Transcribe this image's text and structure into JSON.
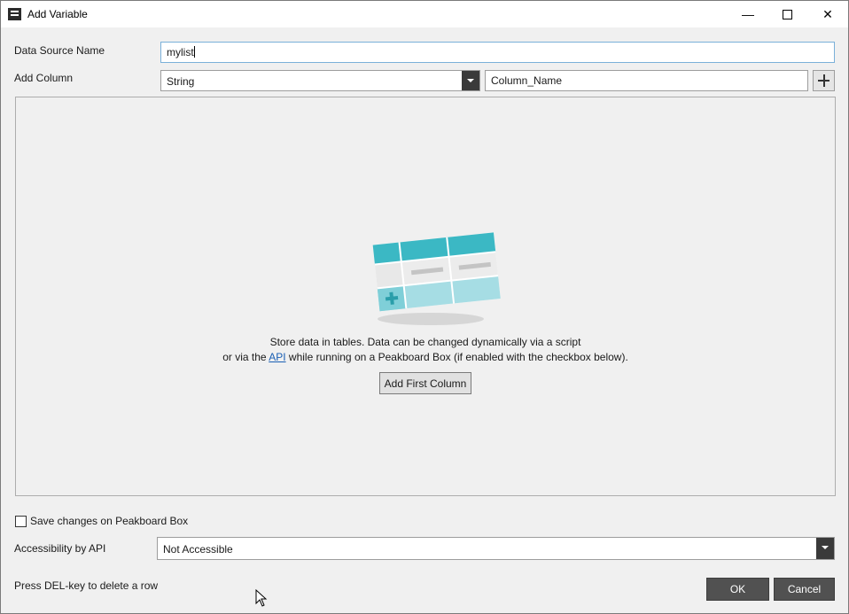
{
  "window": {
    "title": "Add Variable",
    "minimize_icon": "minimize-icon",
    "maximize_icon": "maximize-icon",
    "close_icon": "close-icon"
  },
  "form": {
    "data_source_label": "Data Source Name",
    "data_source_value": "mylist",
    "add_column_label": "Add Column",
    "column_type_value": "String",
    "column_name_value": "Column_Name",
    "add_column_icon": "plus-icon"
  },
  "empty_state": {
    "line1": "Store data in tables. Data can be changed dynamically via a script",
    "line2_prefix": "or via the ",
    "line2_link": "API",
    "line2_suffix": " while running on a Peakboard Box (if enabled with the checkbox below).",
    "add_first_column_label": "Add First Column"
  },
  "footer": {
    "save_changes_label": "Save changes on Peakboard Box",
    "save_changes_checked": false,
    "accessibility_label": "Accessibility by API",
    "accessibility_value": "Not Accessible",
    "hint": "Press DEL-key to delete a row",
    "ok_label": "OK",
    "cancel_label": "Cancel"
  },
  "colors": {
    "accent": "#1a5fb4",
    "dark_button": "#515151",
    "table_teal": "#3bb8c4",
    "table_light_teal": "#a6dde4"
  }
}
